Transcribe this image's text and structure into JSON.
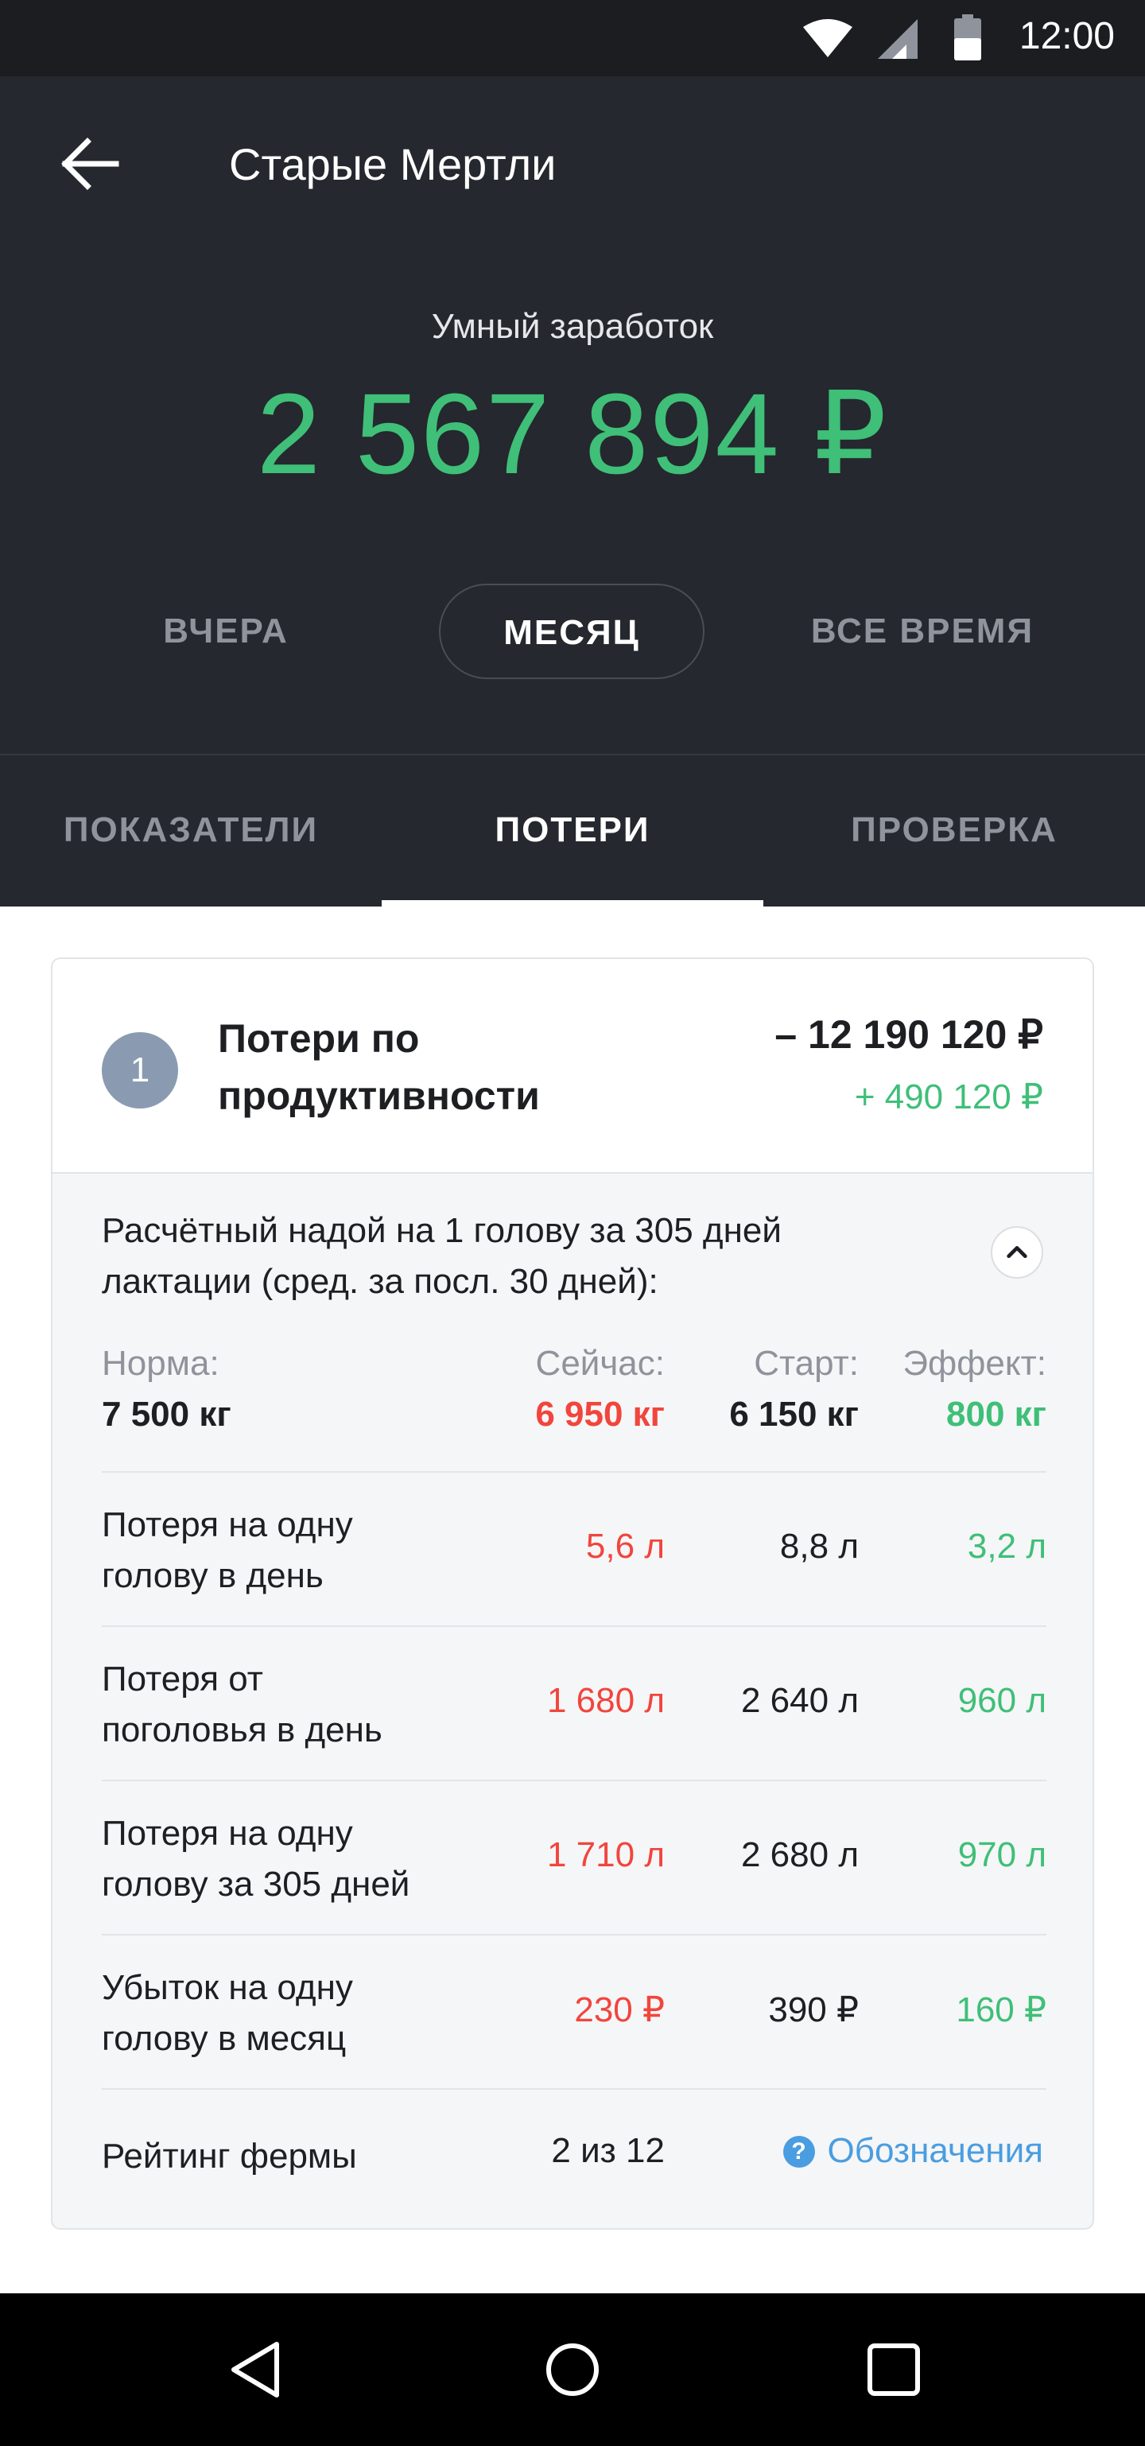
{
  "status_bar": {
    "time": "12:00",
    "icons": [
      "wifi-icon",
      "signal-icon",
      "battery-icon"
    ]
  },
  "header": {
    "title": "Старые Мертли",
    "earnings_label": "Умный заработок",
    "earnings_value": "2 567 894 ₽",
    "periods": [
      {
        "label": "ВЧЕРА",
        "active": false
      },
      {
        "label": "МЕСЯЦ",
        "active": true
      },
      {
        "label": "ВСЕ ВРЕМЯ",
        "active": false
      }
    ]
  },
  "tabs": [
    {
      "label": "ПОКАЗАТЕЛИ",
      "active": false
    },
    {
      "label": "ПОТЕРИ",
      "active": true
    },
    {
      "label": "ПРОВЕРКА",
      "active": false
    }
  ],
  "card": {
    "number": "1",
    "title_line1": "Потери по",
    "title_line2": "продуктивности",
    "total": "– 12 190 120 ₽",
    "gain": "+ 490 120 ₽",
    "description_line1": "Расчётный надой на 1 голову за 305 дней",
    "description_line2": "лактации (сред. за посл. 30 дней):",
    "summary": {
      "norm_label": "Норма:",
      "norm_value": "7 500 кг",
      "now_label": "Сейчас:",
      "now_value": "6 950 кг",
      "start_label": "Старт:",
      "start_value": "6 150 кг",
      "effect_label": "Эффект:",
      "effect_value": "800 кг"
    },
    "rows": [
      {
        "line1": "Потеря на одну",
        "line2": "голову в день",
        "now": "5,6 л",
        "start": "8,8 л",
        "effect": "3,2 л"
      },
      {
        "line1": "Потеря от",
        "line2": "поголовья в день",
        "now": "1 680 л",
        "start": "2 640 л",
        "effect": "960 л"
      },
      {
        "line1": "Потеря на одну",
        "line2": "голову за 305 дней",
        "now": "1 710 л",
        "start": "2 680 л",
        "effect": "970 л"
      },
      {
        "line1": "Убыток на одну",
        "line2": "голову в месяц",
        "now": "230 ₽",
        "start": "390 ₽",
        "effect": "160 ₽"
      }
    ],
    "rating_label": "Рейтинг фермы",
    "rating_value": "2 из 12",
    "legend_label": "Обозначения",
    "legend_icon": "?"
  },
  "colors": {
    "accent_green": "#3fbf78",
    "loss_red": "#f1453d",
    "link_blue": "#4a9de0",
    "header_bg": "#25282e"
  }
}
